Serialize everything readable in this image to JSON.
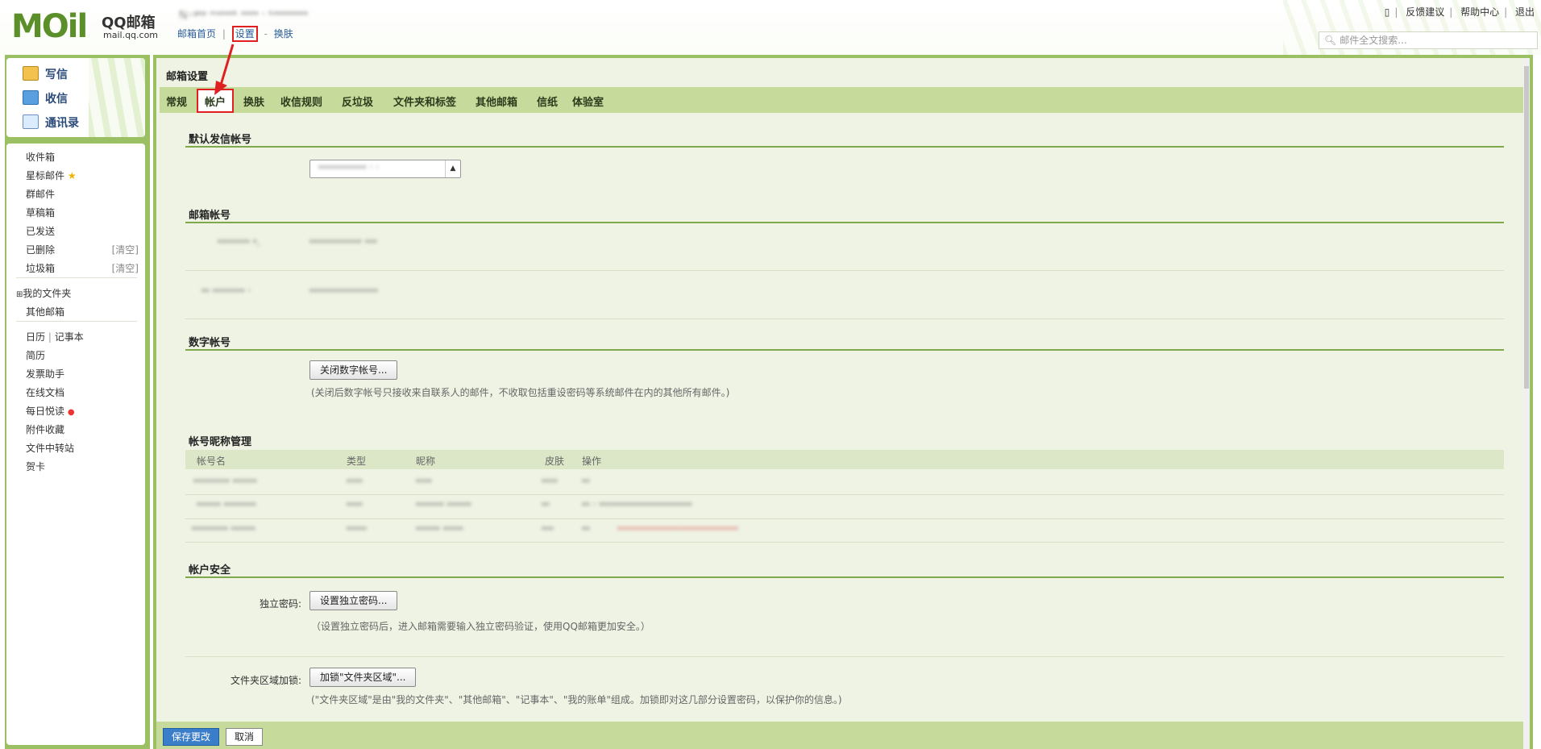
{
  "header": {
    "logo_text": "MOil",
    "brand": "QQ邮箱",
    "domain": "mail.qq.com",
    "username": "ℕ◦ᵍᵉᵖ ᵐˢᵉᵉᵉᵏ ᵉᵉᵉᵉ ˑ ᵏᵉᵉᵉᵉᵉᵉᵉᵉ",
    "links": [
      "邮箱首页",
      "设置",
      "换肤"
    ],
    "link_sep": "|",
    "link_dash": "-",
    "top_links": [
      "反馈建议",
      "帮助中心",
      "退出"
    ],
    "search_placeholder": "邮件全文搜索..."
  },
  "quick": {
    "compose": "写信",
    "inbox": "收信",
    "contacts": "通讯录"
  },
  "folders": {
    "items": [
      "收件箱",
      "星标邮件",
      "群邮件",
      "草稿箱",
      "已发送",
      "已删除",
      "垃圾箱"
    ],
    "clear": "[清空]",
    "my_folders": "我的文件夹",
    "other_mailbox": "其他邮箱",
    "calendar": "日历",
    "notes": "记事本",
    "tools": [
      "简历",
      "发票助手",
      "在线文档",
      "每日悦读",
      "附件收藏",
      "文件中转站",
      "贺卡"
    ]
  },
  "settings": {
    "page_title": "邮箱设置",
    "tabs": [
      "常规",
      "帐户",
      "换肤",
      "收信规则",
      "反垃圾",
      "文件夹和标签",
      "其他邮箱",
      "信纸",
      "体验室"
    ],
    "active_tab": "帐户",
    "default_sender": {
      "title": "默认发信帐号",
      "value": "ᵉᵉᵉᵉᵉᵉᵉᵉᵉᵉᵉᵉ ˑ ˑ"
    },
    "accounts": {
      "title": "邮箱帐号",
      "rows": [
        {
          "name": "ᵉᵉᵉᵉᵉᵉᵉᵉ ᵉ.",
          "email": "ᵉᵉᵉᵉᵉᵉᵉᵉᵉᵉᵉᵉᵉ ᵉᵉᵉ"
        },
        {
          "name": "ᵉᵉ ᵉᵉᵉᵉᵉᵉᵉᵉ ˑ",
          "email": "ᵉᵉᵉᵉᵉᵉᵉᵉᵉᵉᵉᵉᵉᵉᵉᵉᵉ"
        }
      ]
    },
    "digital": {
      "title": "数字帐号",
      "button": "关闭数字帐号...",
      "hint": "(关闭后数字帐号只接收来自联系人的邮件，不收取包括重设密码等系统邮件在内的其他所有邮件。)"
    },
    "nickname": {
      "title": "帐号昵称管理",
      "columns": [
        "帐号名",
        "类型",
        "昵称",
        "皮肤",
        "操作"
      ],
      "rows": [
        [
          "ᵉᵉᵉᵉᵉᵉᵉᵉᵉ ᵉᵉᵉᵉᵉᵉ",
          "ᵉᵉᵉᵉ",
          "ᵉᵉᵉᵉ",
          "ᵉᵉᵉᵉ",
          "ᵉᵉ",
          ""
        ],
        [
          "ᵉᵉᵉᵉᵉᵉ ᵉᵉᵉᵉᵉᵉᵉᵉ",
          "ᵉᵉᵉᵉ",
          "ᵉᵉᵉᵉᵉᵉᵉ ᵉᵉᵉᵉᵉᵉ",
          "ᵉᵉ",
          "ᵉᵉ ˑ ᵉᵉᵉᵉᵉᵉᵉᵉᵉᵉᵉᵉᵉᵉᵉᵉᵉᵉᵉᵉᵉᵉᵉ",
          ""
        ],
        [
          "ᵉᵉᵉᵉᵉᵉᵉᵉᵉ ᵉᵉᵉᵉᵉᵉ",
          "ᵉᵉᵉᵉᵉ",
          "ᵉᵉᵉᵉᵉᵉ ᵉᵉᵉᵉᵉ",
          "ᵉᵉᵉ",
          "ᵉᵉ",
          "ᵉᵉᵉᵉᵉᵉᵉᵉᵉᵉᵉᵉᵉᵉᵉᵉᵉᵉᵉᵉᵉᵉᵉᵉᵉᵉᵉᵉᵉᵉ"
        ]
      ]
    },
    "security": {
      "title": "帐户安全",
      "pwd_label": "独立密码:",
      "pwd_button": "设置独立密码...",
      "pwd_hint": "（设置独立密码后，进入邮箱需要输入独立密码验证，使用QQ邮箱更加安全。）",
      "lock_label": "文件夹区域加锁:",
      "lock_button": "加锁\"文件夹区域\"...",
      "lock_hint": "(\"文件夹区域\"是由\"我的文件夹\"、\"其他邮箱\"、\"记事本\"、\"我的账单\"组成。加锁即对这几部分设置密码，以保护你的信息。)"
    },
    "save": "保存更改",
    "cancel": "取消"
  },
  "colors": {
    "frame_green": "#9bc063",
    "tab_bar": "#c6da9c",
    "content_bg": "#eef3e4",
    "highlight_red": "#e02020",
    "link_blue": "#2a5d9a"
  }
}
